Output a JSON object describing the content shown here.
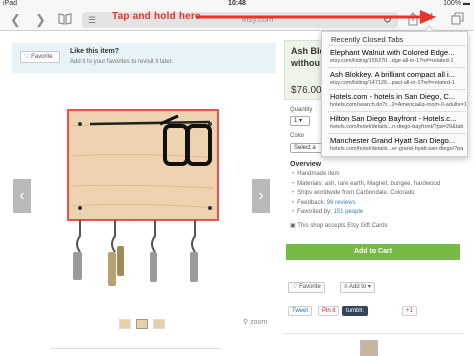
{
  "status_bar": {
    "device": "iPad",
    "time": "10:48",
    "battery": "100%"
  },
  "toolbar": {
    "callout": "Tap and hold here",
    "url": "etsy.com",
    "back_icon": "chevron-left-icon",
    "forward_icon": "chevron-right-icon",
    "bookmarks_icon": "book-icon",
    "share_icon": "share-icon",
    "new_tab_icon": "plus-icon",
    "tabs_icon": "tabs-icon"
  },
  "favorite_panel": {
    "button": "Favorite",
    "title": "Like this item?",
    "subtitle": "Add it to your favorites to revisit it later."
  },
  "listing": {
    "title_line1": "Ash Blo",
    "title_line2": "withou",
    "price": "$76.00",
    "quantity_label": "Quantity",
    "quantity_value": "1",
    "color_label": "Color",
    "color_value": "Select a",
    "zoom": "zoom"
  },
  "overview": {
    "title": "Overview",
    "items": [
      {
        "text": "Handmade item"
      },
      {
        "text": "Materials: ash, rare earth, Magnet, bungee, hardwood"
      },
      {
        "text": "Ships worldwide from Carbondale, Colorado"
      },
      {
        "text": "Feedback: ",
        "link": "98 reviews"
      },
      {
        "text": "Favorited by: ",
        "link": "151 people"
      }
    ],
    "giftcard": "This shop accepts Etsy Gift Cards"
  },
  "buttons": {
    "add_to_cart": "Add to Cart",
    "favorite": "Favorite",
    "add_to": "Add to",
    "tweet": "Tweet",
    "pin": "Pin it",
    "tumblr": "tumblr.",
    "plus_one": "+1"
  },
  "recent_tabs": {
    "header": "Recently Closed Tabs",
    "items": [
      {
        "title": "Elephant Walnut with Colored Edge...",
        "url": "etsy.com/listing/155370...dge-all-in-1?ref=related-1"
      },
      {
        "title": "Ash Blokkey. A brilliant compact all i...",
        "url": "etsy.com/listing/147126...pact-all-in-1?ref=related-1"
      },
      {
        "title": "Hotels.com - hotels in San Diego, C...",
        "url": "hotels.com/search.do?r...2=America&q-room-0-adults=1"
      },
      {
        "title": "Hilton San Diego Bayfront - Hotels.c...",
        "url": "hotels.com/hotel/details...n-diego-bayfront/?pa=26&tab"
      },
      {
        "title": "Manchester Grand Hyatt San Diego...",
        "url": "hotels.com/hotel/details...er-grand-hyatt-san-diego/?pa"
      }
    ]
  },
  "colors": {
    "accent_red": "#e8342b",
    "cart_green": "#76b944",
    "link_blue": "#3a7fc1"
  }
}
